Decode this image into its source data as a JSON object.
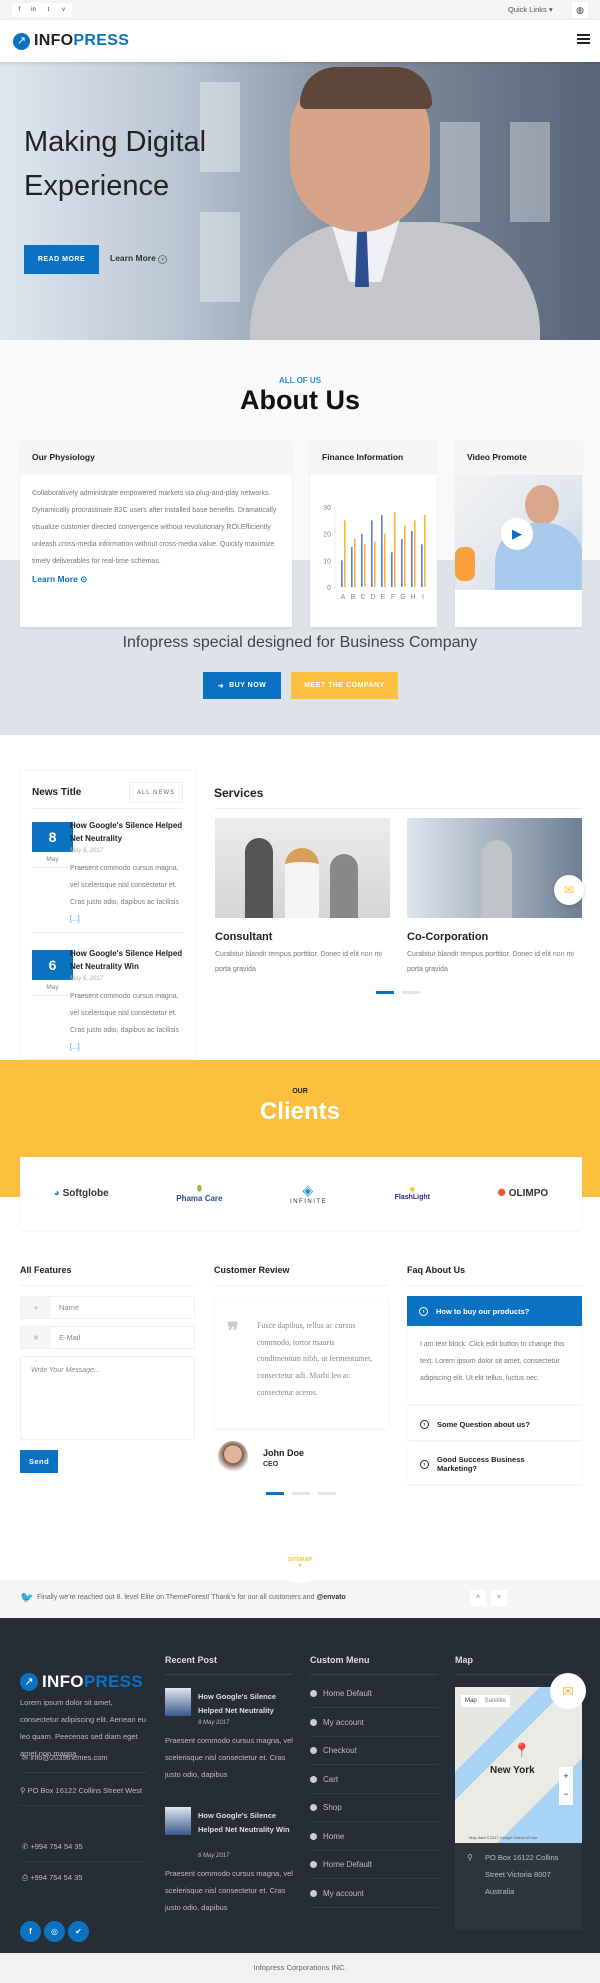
{
  "topbar": {
    "social": [
      "f",
      "in",
      "t",
      "v"
    ],
    "quick_links": "Quick Links ▾",
    "globe_icon": "globe-icon"
  },
  "header": {
    "logo_a": "INFO",
    "logo_b": "PRESS",
    "menu_icon": "hamburger-icon"
  },
  "hero": {
    "title_line1": "Making Digital",
    "title_line2": "Experience",
    "read_more": "READ MORE",
    "learn_more": "Learn More"
  },
  "about": {
    "eyebrow": "ALL OF US",
    "title": "About Us",
    "cards": [
      {
        "title": "Our Physiology",
        "text": "Collaboratively administrate empowered markets via plug-and-play networks. Dynamically procrastinate B2C users after installed base benefits. Dramatically visualize customer directed convergence without revolutionary ROI.Efficiently unleash cross-media information without cross-media value. Quickly maximize timely deliverables for real-time schemas.",
        "link": "Learn More"
      },
      {
        "title": "Finance Information"
      },
      {
        "title": "Video Promote"
      }
    ],
    "tagline": "Infopress special designed for Business Company",
    "buy_now": "BUY NOW",
    "meet": "MEET THE COMPANY"
  },
  "chart_data": {
    "type": "bar",
    "categories": [
      "A",
      "B",
      "C",
      "D",
      "E",
      "F",
      "G",
      "H",
      "I"
    ],
    "series": [
      {
        "values": [
          10,
          15,
          20,
          25,
          27,
          13,
          18,
          21,
          16
        ],
        "color": "#5b7be0"
      },
      {
        "values": [
          25,
          18,
          16,
          17,
          20,
          28,
          23,
          25,
          27
        ],
        "color": "#fbb43a"
      }
    ],
    "yticks": [
      0,
      10,
      20,
      30
    ],
    "ylim": [
      0,
      30
    ],
    "grid": false
  },
  "news": {
    "title": "News Title",
    "all_news": "ALL NEWS",
    "items": [
      {
        "day": "8",
        "month": "May",
        "title": "How Google's Silence Helped Net Neutrality",
        "date": "May 8, 2017",
        "text": "Praesent commodo cursus magna, vel scelerisque nisl consectetur et. Cras justo odio, dapibus ac facilisis",
        "more": "[...]"
      },
      {
        "day": "6",
        "month": "May",
        "title": "How Google's Silence Helped Net Neutrality Win",
        "date": "May 6, 2017",
        "text": "Praesent commodo cursus magna, vel scelerisque nisl consectetur et. Cras justo odio, dapibus ac facilisis",
        "more": "[...]"
      }
    ]
  },
  "services": {
    "title": "Services",
    "items": [
      {
        "title": "Consultant",
        "text": "Curabitur blandit tempus porttitor. Donec id elit non mi porta gravida"
      },
      {
        "title": "Co-Corporation",
        "text": "Curabitur blandit tempus porttitor. Donec id elit non mi porta gravida"
      }
    ]
  },
  "clients": {
    "eyebrow": "OUR",
    "title": "Clients",
    "logos": [
      "Softglobe",
      "Phama Care",
      "INFINITE",
      "FlashLight",
      "OLIMPO"
    ]
  },
  "features": {
    "title": "All Features",
    "name_ph": "Name",
    "email_ph": "E-Mail",
    "message_ph": "Write Your Message...",
    "send": "Send"
  },
  "review": {
    "title": "Customer Review",
    "quote": "Fusce dapibus, tellus ac cursus commodo, tortor mauris condimentum nibh, ut fermentumet, consectetur adi. Morbi leo ac consectetur aceros.",
    "name": "John Doe",
    "role": "CEO"
  },
  "faq": {
    "title": "Faq About Us",
    "items": [
      {
        "q": "How to buy our products?",
        "a": "I am text block. Click edit button to change this text. Lorem ipsum dolor sit amet, consectetur adipiscing elit. Ut elit tellus, luctus nec."
      },
      {
        "q": "Some Question about us?"
      },
      {
        "q": "Good Success Business Marketing?"
      }
    ]
  },
  "sitemap": "SITEMAP",
  "tweet": {
    "text": "Finally we're reached out 8. level Elite on ThemeForest! Thank's for our all customers and ",
    "handle": "@envato"
  },
  "footer": {
    "about": "Lorem ipsum dolor sit amet, consectetur adipiscing elit. Aenean eu leo quam. Peecenas sed diam eget amet non magna.",
    "email": "info@2035themes.com",
    "address": "PO Box 16122 Collins Street West",
    "phone": "+994 754 54 35",
    "fax": "+994 754 54 35",
    "recent_title": "Recent Post",
    "posts": [
      {
        "title": "How Google's Silence Helped Net Neutrality",
        "date": "8 May 2017",
        "text": "Praesent commodo cursus magna, vel scelerisque nisl consectetur et. Cras justo odio, dapibus"
      },
      {
        "title": "How Google's Silence Helped Net Neutrality Win",
        "date": "6 May 2017",
        "text": "Praesent commodo cursus magna, vel scelerisque nisl consectetur et. Cras justo odio, dapibus"
      }
    ],
    "menu_title": "Custom Menu",
    "menu": [
      "Home Default",
      "My account",
      "Checkout",
      "Cart",
      "Shop",
      "Home",
      "Home Default",
      "My account"
    ],
    "map_title": "Map",
    "map_tabs": [
      "Map",
      "Satellite"
    ],
    "map_city": "New York",
    "map_credit": "Map data ©2017 Google  Terms of Use",
    "map_address": "PO Box 16122 Collins Street Victoria 8007 Australia"
  },
  "copyright": "Infopress Corporations INC.",
  "colors": {
    "blue": "#0b72c1",
    "yellow": "#fcbf3e",
    "footer": "#262d36"
  }
}
